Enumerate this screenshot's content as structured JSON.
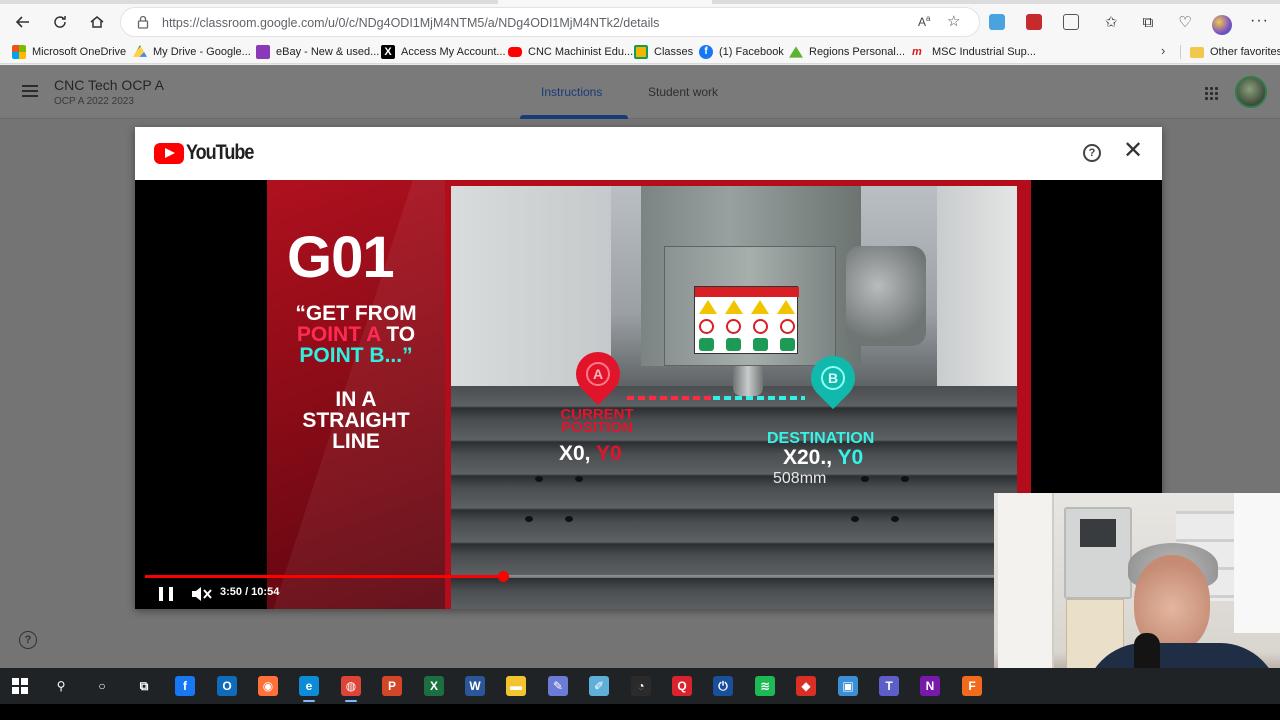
{
  "browser": {
    "url": "https://classroom.google.com/u/0/c/NDg4ODI1MjM4NTM5/a/NDg4ODI1MjM4NTk2/details",
    "bookmarks": [
      {
        "label": "Microsoft OneDrive",
        "icon": "microsoft-icon",
        "color": "#f25022"
      },
      {
        "label": "My Drive - Google...",
        "icon": "google-drive-icon",
        "color": "#1fa463"
      },
      {
        "label": "eBay - New & used...",
        "icon": "ebay-bag-icon",
        "color": "#8a3ab9"
      },
      {
        "label": "Access My Account...",
        "icon": "x-icon",
        "color": "#000000"
      },
      {
        "label": "CNC Machinist Edu...",
        "icon": "youtube-icon",
        "color": "#ff0000"
      },
      {
        "label": "Classes",
        "icon": "classroom-icon",
        "color": "#f4b400"
      },
      {
        "label": "(1) Facebook",
        "icon": "facebook-icon",
        "color": "#1877f2"
      },
      {
        "label": "Regions   Personal...",
        "icon": "regions-icon",
        "color": "#5fb332"
      },
      {
        "label": "MSC Industrial Sup...",
        "icon": "msc-icon",
        "color": "#d71920"
      }
    ],
    "other_favorites": "Other favorites"
  },
  "classroom": {
    "course_title": "CNC Tech OCP A",
    "course_subtitle": "OCP A 2022 2023",
    "tabs": [
      {
        "label": "Instructions",
        "active": true
      },
      {
        "label": "Student work",
        "active": false
      }
    ]
  },
  "youtube_modal": {
    "logo_text": "YouTube",
    "help_glyph": "?",
    "close_glyph": "✕",
    "video": {
      "slide": {
        "code": "G01",
        "quote_line1": "“GET FROM",
        "quote_point_a": "POINT A",
        "quote_to": " TO",
        "quote_point_b": "POINT B...”",
        "line_in_a": "IN A",
        "line_straight": "STRAIGHT",
        "line_line": "LINE"
      },
      "overlay": {
        "pin_a": "A",
        "pin_b": "B",
        "current_label_1": "CURRENT",
        "current_label_2": "POSITION",
        "current_x": "X0,",
        "current_y": " Y0",
        "destination_label": "DESTINATION",
        "dest_x": "X20.,",
        "dest_y": " Y0",
        "distance": "508mm"
      },
      "time_display": "3:50 / 10:54",
      "progress_fraction": 0.3555,
      "colors": {
        "progress": "#ff0000",
        "accent_red": "#b30d1c",
        "accent_cyan": "#2ff0e0"
      }
    }
  },
  "help_glyph": "?",
  "taskbar": {
    "icons": [
      {
        "name": "search-icon",
        "glyph": "⚲",
        "color": "#202326"
      },
      {
        "name": "cortana-icon",
        "glyph": "○",
        "color": "#202326"
      },
      {
        "name": "task-view-icon",
        "glyph": "⧉",
        "color": "#202326"
      },
      {
        "name": "facebook-app-icon",
        "glyph": "f",
        "color": "#1877f2"
      },
      {
        "name": "outlook-icon",
        "glyph": "O",
        "color": "#0f6cbd"
      },
      {
        "name": "firefox-icon",
        "glyph": "◉",
        "color": "#ff7139"
      },
      {
        "name": "edge-icon",
        "glyph": "e",
        "color": "#0c8cd8"
      },
      {
        "name": "chrome-icon",
        "glyph": "◍",
        "color": "#db4437"
      },
      {
        "name": "powerpoint-icon",
        "glyph": "P",
        "color": "#d24726"
      },
      {
        "name": "excel-icon",
        "glyph": "X",
        "color": "#1d6f42"
      },
      {
        "name": "word-icon",
        "glyph": "W",
        "color": "#2b579a"
      },
      {
        "name": "file-explorer-icon",
        "glyph": "▬",
        "color": "#f4c430"
      },
      {
        "name": "paint-icon",
        "glyph": "✎",
        "color": "#6b7bd6"
      },
      {
        "name": "notes-icon",
        "glyph": "✐",
        "color": "#5fb0d8"
      },
      {
        "name": "clock-app-icon",
        "glyph": "◔",
        "color": "#2b2b2b"
      },
      {
        "name": "q-app-icon",
        "glyph": "Q",
        "color": "#d9232e"
      },
      {
        "name": "power-app-icon",
        "glyph": "⏻",
        "color": "#1a4f9c"
      },
      {
        "name": "spotify-icon",
        "glyph": "≋",
        "color": "#1db954"
      },
      {
        "name": "red-app-icon",
        "glyph": "◆",
        "color": "#d93025"
      },
      {
        "name": "snip-icon",
        "glyph": "▣",
        "color": "#3b8fd6"
      },
      {
        "name": "teams-icon",
        "glyph": "T",
        "color": "#5b5fc7"
      },
      {
        "name": "onenote-icon",
        "glyph": "N",
        "color": "#7719aa"
      },
      {
        "name": "fusion-icon",
        "glyph": "F",
        "color": "#f26a1b"
      }
    ]
  }
}
